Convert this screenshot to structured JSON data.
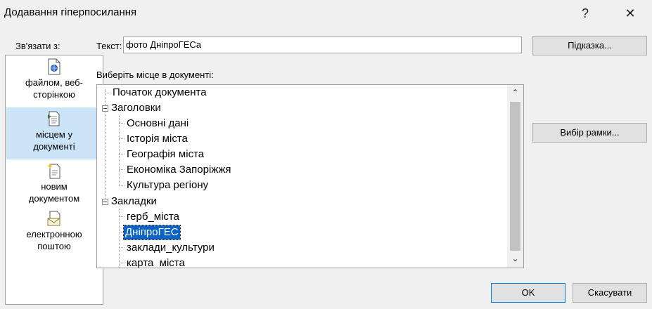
{
  "window": {
    "title": "Додавання гіперпосилання",
    "help_symbol": "?",
    "close_symbol": "✕"
  },
  "link_to": {
    "label": "Зв'язати з:",
    "items": [
      {
        "line1": "файлом, веб-",
        "line2": "сторінкою",
        "icon": "web-file-icon",
        "selected": false
      },
      {
        "line1": "місцем у",
        "line2": "документі",
        "icon": "document-place-icon",
        "selected": true
      },
      {
        "line1": "новим",
        "line2": "документом",
        "icon": "new-document-icon",
        "selected": false
      },
      {
        "line1": "електронною",
        "line2": "поштою",
        "icon": "email-icon",
        "selected": false
      }
    ]
  },
  "text_field": {
    "label": "Текст:",
    "value": "фото ДніпроГЕСа"
  },
  "screentip_button": "Підказка...",
  "place": {
    "label": "Виберіть місце в документі:",
    "tree": [
      {
        "label": "Початок документа",
        "level": 0,
        "type": "leaf"
      },
      {
        "label": "Заголовки",
        "level": 0,
        "type": "group"
      },
      {
        "label": "Основні дані",
        "level": 1,
        "type": "leaf"
      },
      {
        "label": "Історія міста",
        "level": 1,
        "type": "leaf"
      },
      {
        "label": "Географія міста",
        "level": 1,
        "type": "leaf"
      },
      {
        "label": "Економіка Запоріжжя",
        "level": 1,
        "type": "leaf"
      },
      {
        "label": "Культура регіону",
        "level": 1,
        "type": "leaf"
      },
      {
        "label": "Закладки",
        "level": 0,
        "type": "group"
      },
      {
        "label": "герб_міста",
        "level": 1,
        "type": "leaf"
      },
      {
        "label": "ДніпроГЕС",
        "level": 1,
        "type": "leaf",
        "selected": true
      },
      {
        "label": "заклади_культури",
        "level": 1,
        "type": "leaf"
      },
      {
        "label": "карта_міста",
        "level": 1,
        "type": "leaf"
      }
    ]
  },
  "frame_button": "Вибір рамки...",
  "ok_button": "OK",
  "cancel_button": "Скасувати",
  "colors": {
    "selection": "#0a64c8",
    "sidebar_selected": "#cce4f7"
  }
}
